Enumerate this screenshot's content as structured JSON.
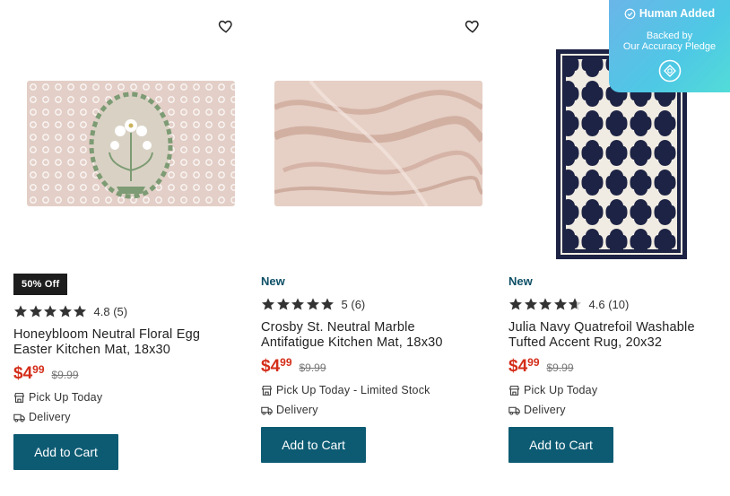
{
  "products": [
    {
      "badge": "50% Off",
      "rating_value": "4.8",
      "rating_count": "(5)",
      "stars": 5,
      "title_line1": "Honeybloom Neutral Floral Egg",
      "title_line2": "Easter Kitchen Mat, 18x30",
      "price_dollars": "$4",
      "price_cents": "99",
      "was_price": "$9.99",
      "pickup": "Pick Up Today",
      "delivery": "Delivery",
      "cart_label": "Add to Cart"
    },
    {
      "tag": "New",
      "rating_value": "5",
      "rating_count": "(6)",
      "stars": 5,
      "title_line1": "Crosby St. Neutral Marble",
      "title_line2": "Antifatigue Kitchen Mat, 18x30",
      "price_dollars": "$4",
      "price_cents": "99",
      "was_price": "$9.99",
      "pickup": "Pick Up Today - Limited Stock",
      "delivery": "Delivery",
      "cart_label": "Add to Cart"
    },
    {
      "tag": "New",
      "rating_value": "4.6",
      "rating_count": "(10)",
      "stars": 4.6,
      "title_line1": "Julia Navy Quatrefoil Washable",
      "title_line2": "Tufted Accent Rug, 20x32",
      "price_dollars": "$4",
      "price_cents": "99",
      "was_price": "$9.99",
      "pickup": "Pick Up Today",
      "delivery": "Delivery",
      "cart_label": "Add to Cart"
    }
  ],
  "pledge": {
    "title": "Human Added",
    "line1": "Backed by",
    "line2": "Our Accuracy Pledge"
  },
  "colors": {
    "sale_price": "#d42d19",
    "button": "#0d5b73",
    "new_tag": "#0d4f66"
  },
  "icons": {
    "favorite": "heart-outline-icon",
    "pickup": "store-icon",
    "delivery": "truck-icon",
    "pledge_check": "check-circle-icon",
    "pledge_seal": "seal-icon"
  }
}
